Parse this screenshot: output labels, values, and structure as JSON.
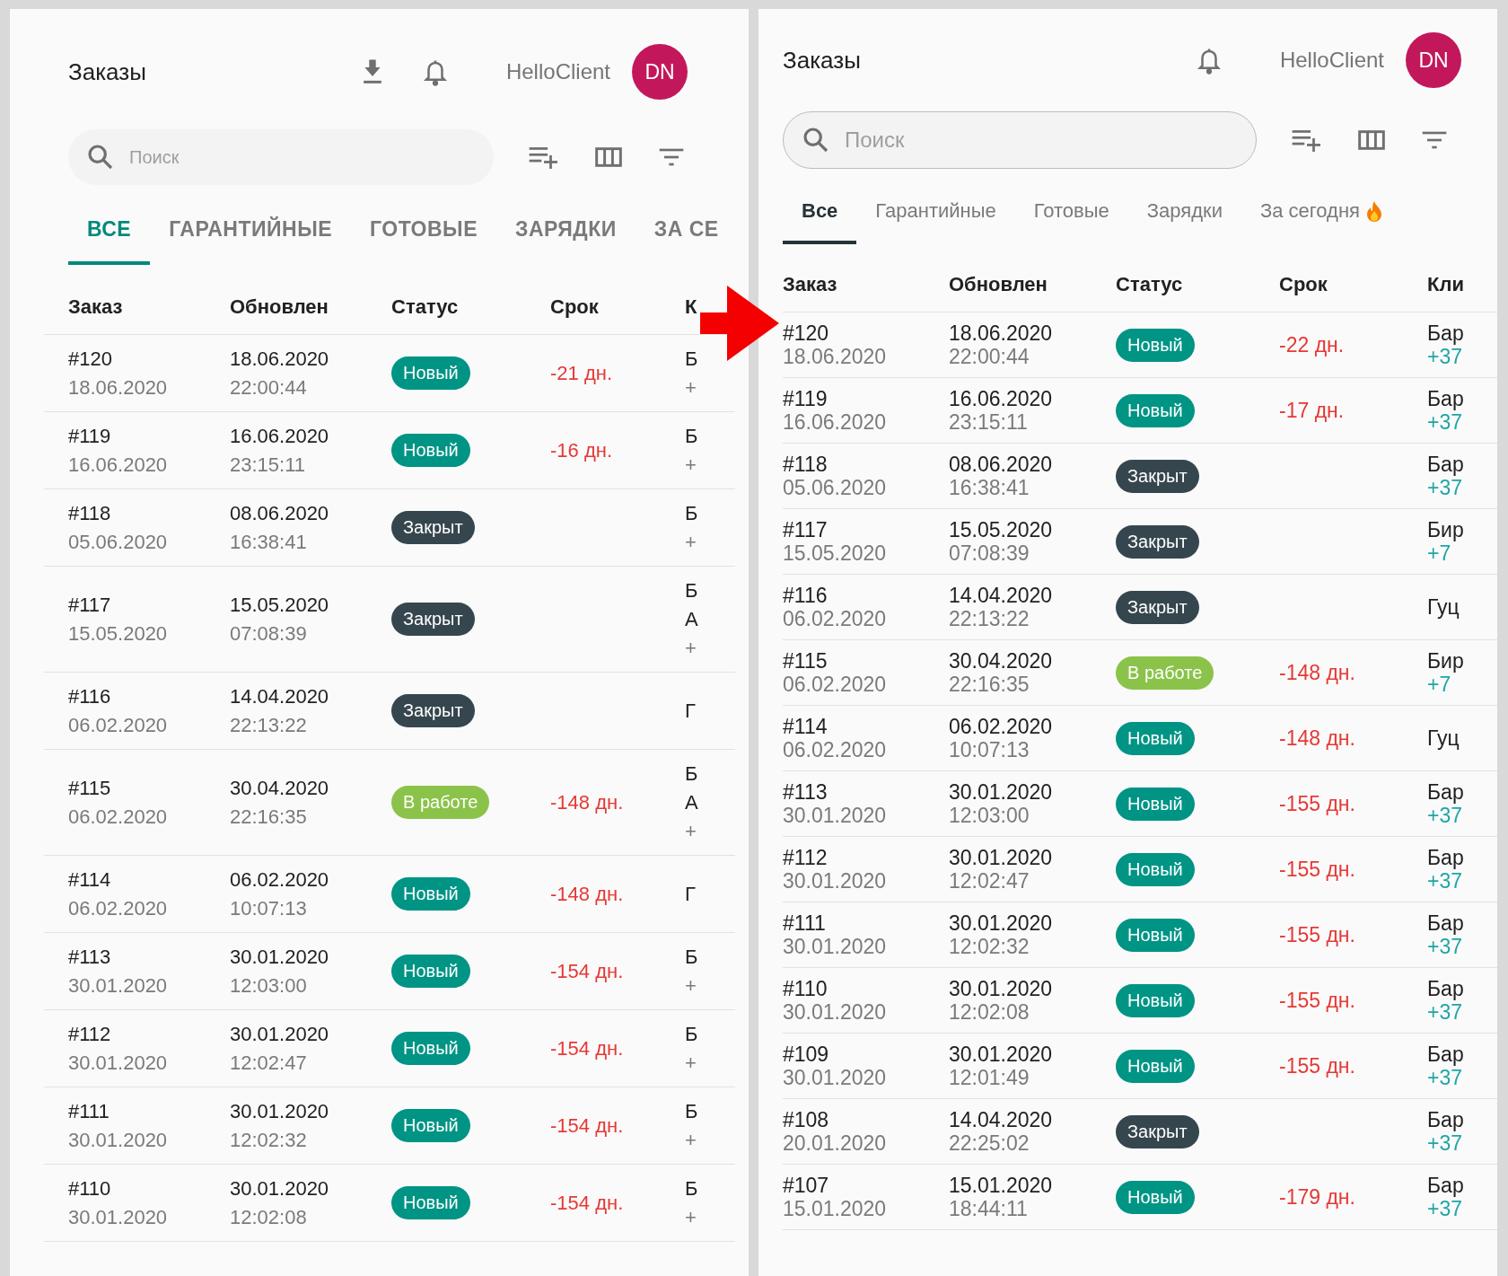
{
  "panels": [
    {
      "kind": "uppercase",
      "title": "Заказы",
      "user": "HelloClient",
      "avatar": "DN",
      "search": {
        "placeholder": "Поиск"
      },
      "tabs": [
        {
          "label": "ВСЕ",
          "selected": true,
          "hot": false
        },
        {
          "label": "ГАРАНТИЙНЫЕ",
          "selected": false,
          "hot": false
        },
        {
          "label": "ГОТОВЫЕ",
          "selected": false,
          "hot": false
        },
        {
          "label": "ЗАРЯДКИ",
          "selected": false,
          "hot": false
        },
        {
          "label": "ЗА СЕ",
          "selected": false,
          "hot": false
        }
      ],
      "columns": [
        "Заказ",
        "Обновлен",
        "Статус",
        "Срок",
        "К"
      ],
      "rows": [
        {
          "order": "#120",
          "created": "18.06.2020",
          "updated_date": "18.06.2020",
          "updated_time": "22:00:44",
          "status": {
            "label": "Новый",
            "color": "#009485"
          },
          "deadline": "-21 дн.",
          "client": [
            {
              "text": "Б",
              "kind": "name"
            },
            {
              "text": "+",
              "kind": "phone"
            }
          ]
        },
        {
          "order": "#119",
          "created": "16.06.2020",
          "updated_date": "16.06.2020",
          "updated_time": "23:15:11",
          "status": {
            "label": "Новый",
            "color": "#009485"
          },
          "deadline": "-16 дн.",
          "client": [
            {
              "text": "Б",
              "kind": "name"
            },
            {
              "text": "+",
              "kind": "phone"
            }
          ]
        },
        {
          "order": "#118",
          "created": "05.06.2020",
          "updated_date": "08.06.2020",
          "updated_time": "16:38:41",
          "status": {
            "label": "Закрыт",
            "color": "#36464e"
          },
          "client": [
            {
              "text": "Б",
              "kind": "name"
            },
            {
              "text": "+",
              "kind": "phone"
            }
          ]
        },
        {
          "order": "#117",
          "created": "15.05.2020",
          "updated_date": "15.05.2020",
          "updated_time": "07:08:39",
          "status": {
            "label": "Закрыт",
            "color": "#36464e"
          },
          "client": [
            {
              "text": "Б",
              "kind": "name"
            },
            {
              "text": "А",
              "kind": "name"
            },
            {
              "text": "+",
              "kind": "phone"
            }
          ]
        },
        {
          "order": "#116",
          "created": "06.02.2020",
          "updated_date": "14.04.2020",
          "updated_time": "22:13:22",
          "status": {
            "label": "Закрыт",
            "color": "#36464e"
          },
          "client": [
            {
              "text": "Г",
              "kind": "name"
            }
          ]
        },
        {
          "order": "#115",
          "created": "06.02.2020",
          "updated_date": "30.04.2020",
          "updated_time": "22:16:35",
          "status": {
            "label": "В работе",
            "color": "#8bc34a"
          },
          "deadline": "-148 дн.",
          "client": [
            {
              "text": "Б",
              "kind": "name"
            },
            {
              "text": "А",
              "kind": "name"
            },
            {
              "text": "+",
              "kind": "phone"
            }
          ]
        },
        {
          "order": "#114",
          "created": "06.02.2020",
          "updated_date": "06.02.2020",
          "updated_time": "10:07:13",
          "status": {
            "label": "Новый",
            "color": "#009485"
          },
          "deadline": "-148 дн.",
          "client": [
            {
              "text": "Г",
              "kind": "name"
            }
          ]
        },
        {
          "order": "#113",
          "created": "30.01.2020",
          "updated_date": "30.01.2020",
          "updated_time": "12:03:00",
          "status": {
            "label": "Новый",
            "color": "#009485"
          },
          "deadline": "-154 дн.",
          "client": [
            {
              "text": "Б",
              "kind": "name"
            },
            {
              "text": "+",
              "kind": "phone"
            }
          ]
        },
        {
          "order": "#112",
          "created": "30.01.2020",
          "updated_date": "30.01.2020",
          "updated_time": "12:02:47",
          "status": {
            "label": "Новый",
            "color": "#009485"
          },
          "deadline": "-154 дн.",
          "client": [
            {
              "text": "Б",
              "kind": "name"
            },
            {
              "text": "+",
              "kind": "phone"
            }
          ]
        },
        {
          "order": "#111",
          "created": "30.01.2020",
          "updated_date": "30.01.2020",
          "updated_time": "12:02:32",
          "status": {
            "label": "Новый",
            "color": "#009485"
          },
          "deadline": "-154 дн.",
          "client": [
            {
              "text": "Б",
              "kind": "name"
            },
            {
              "text": "+",
              "kind": "phone"
            }
          ]
        },
        {
          "order": "#110",
          "created": "30.01.2020",
          "updated_date": "30.01.2020",
          "updated_time": "12:02:08",
          "status": {
            "label": "Новый",
            "color": "#009485"
          },
          "deadline": "-154 дн.",
          "client": [
            {
              "text": "Б",
              "kind": "name"
            },
            {
              "text": "+",
              "kind": "phone"
            }
          ]
        }
      ]
    },
    {
      "kind": "outlined",
      "title": "Заказы",
      "user": "HelloClient",
      "avatar": "DN",
      "search": {
        "placeholder": "Поиск"
      },
      "tabs": [
        {
          "label": "Все",
          "selected": true,
          "hot": false
        },
        {
          "label": "Гарантийные",
          "selected": false,
          "hot": false
        },
        {
          "label": "Готовые",
          "selected": false,
          "hot": false
        },
        {
          "label": "Зарядки",
          "selected": false,
          "hot": false
        },
        {
          "label": "За сегодня",
          "selected": false,
          "hot": true
        }
      ],
      "columns": [
        "Заказ",
        "Обновлен",
        "Статус",
        "Срок",
        "Кли"
      ],
      "rows": [
        {
          "order": "#120",
          "created": "18.06.2020",
          "updated_date": "18.06.2020",
          "updated_time": "22:00:44",
          "status": {
            "label": "Новый",
            "color": "#009485"
          },
          "deadline": "-22 дн.",
          "client": [
            {
              "text": "Бар",
              "kind": "name"
            },
            {
              "text": "+37",
              "kind": "phone"
            }
          ]
        },
        {
          "order": "#119",
          "created": "16.06.2020",
          "updated_date": "16.06.2020",
          "updated_time": "23:15:11",
          "status": {
            "label": "Новый",
            "color": "#009485"
          },
          "deadline": "-17 дн.",
          "client": [
            {
              "text": "Бар",
              "kind": "name"
            },
            {
              "text": "+37",
              "kind": "phone"
            }
          ]
        },
        {
          "order": "#118",
          "created": "05.06.2020",
          "updated_date": "08.06.2020",
          "updated_time": "16:38:41",
          "status": {
            "label": "Закрыт",
            "color": "#36464e"
          },
          "client": [
            {
              "text": "Бар",
              "kind": "name"
            },
            {
              "text": "+37",
              "kind": "phone"
            }
          ]
        },
        {
          "order": "#117",
          "created": "15.05.2020",
          "updated_date": "15.05.2020",
          "updated_time": "07:08:39",
          "status": {
            "label": "Закрыт",
            "color": "#36464e"
          },
          "client": [
            {
              "text": "Бир",
              "kind": "name"
            },
            {
              "text": "+7",
              "kind": "phone"
            }
          ]
        },
        {
          "order": "#116",
          "created": "06.02.2020",
          "updated_date": "14.04.2020",
          "updated_time": "22:13:22",
          "status": {
            "label": "Закрыт",
            "color": "#36464e"
          },
          "client": [
            {
              "text": "Гуц",
              "kind": "name"
            }
          ]
        },
        {
          "order": "#115",
          "created": "06.02.2020",
          "updated_date": "30.04.2020",
          "updated_time": "22:16:35",
          "status": {
            "label": "В работе",
            "color": "#8bc34a"
          },
          "deadline": "-148 дн.",
          "client": [
            {
              "text": "Бир",
              "kind": "name"
            },
            {
              "text": "+7",
              "kind": "phone"
            }
          ]
        },
        {
          "order": "#114",
          "created": "06.02.2020",
          "updated_date": "06.02.2020",
          "updated_time": "10:07:13",
          "status": {
            "label": "Новый",
            "color": "#009485"
          },
          "deadline": "-148 дн.",
          "client": [
            {
              "text": "Гуц",
              "kind": "name"
            }
          ]
        },
        {
          "order": "#113",
          "created": "30.01.2020",
          "updated_date": "30.01.2020",
          "updated_time": "12:03:00",
          "status": {
            "label": "Новый",
            "color": "#009485"
          },
          "deadline": "-155 дн.",
          "client": [
            {
              "text": "Бар",
              "kind": "name"
            },
            {
              "text": "+37",
              "kind": "phone"
            }
          ]
        },
        {
          "order": "#112",
          "created": "30.01.2020",
          "updated_date": "30.01.2020",
          "updated_time": "12:02:47",
          "status": {
            "label": "Новый",
            "color": "#009485"
          },
          "deadline": "-155 дн.",
          "client": [
            {
              "text": "Бар",
              "kind": "name"
            },
            {
              "text": "+37",
              "kind": "phone"
            }
          ]
        },
        {
          "order": "#111",
          "created": "30.01.2020",
          "updated_date": "30.01.2020",
          "updated_time": "12:02:32",
          "status": {
            "label": "Новый",
            "color": "#009485"
          },
          "deadline": "-155 дн.",
          "client": [
            {
              "text": "Бар",
              "kind": "name"
            },
            {
              "text": "+37",
              "kind": "phone"
            }
          ]
        },
        {
          "order": "#110",
          "created": "30.01.2020",
          "updated_date": "30.01.2020",
          "updated_time": "12:02:08",
          "status": {
            "label": "Новый",
            "color": "#009485"
          },
          "deadline": "-155 дн.",
          "client": [
            {
              "text": "Бар",
              "kind": "name"
            },
            {
              "text": "+37",
              "kind": "phone"
            }
          ]
        },
        {
          "order": "#109",
          "created": "30.01.2020",
          "updated_date": "30.01.2020",
          "updated_time": "12:01:49",
          "status": {
            "label": "Новый",
            "color": "#009485"
          },
          "deadline": "-155 дн.",
          "client": [
            {
              "text": "Бар",
              "kind": "name"
            },
            {
              "text": "+37",
              "kind": "phone"
            }
          ]
        },
        {
          "order": "#108",
          "created": "20.01.2020",
          "updated_date": "14.04.2020",
          "updated_time": "22:25:02",
          "status": {
            "label": "Закрыт",
            "color": "#36464e"
          },
          "client": [
            {
              "text": "Бар",
              "kind": "name"
            },
            {
              "text": "+37",
              "kind": "phone"
            }
          ]
        },
        {
          "order": "#107",
          "created": "15.01.2020",
          "updated_date": "15.01.2020",
          "updated_time": "18:44:11",
          "status": {
            "label": "Новый",
            "color": "#009485"
          },
          "deadline": "-179 дн.",
          "client": [
            {
              "text": "Бар",
              "kind": "name"
            },
            {
              "text": "+37",
              "kind": "phone"
            }
          ]
        }
      ]
    }
  ]
}
